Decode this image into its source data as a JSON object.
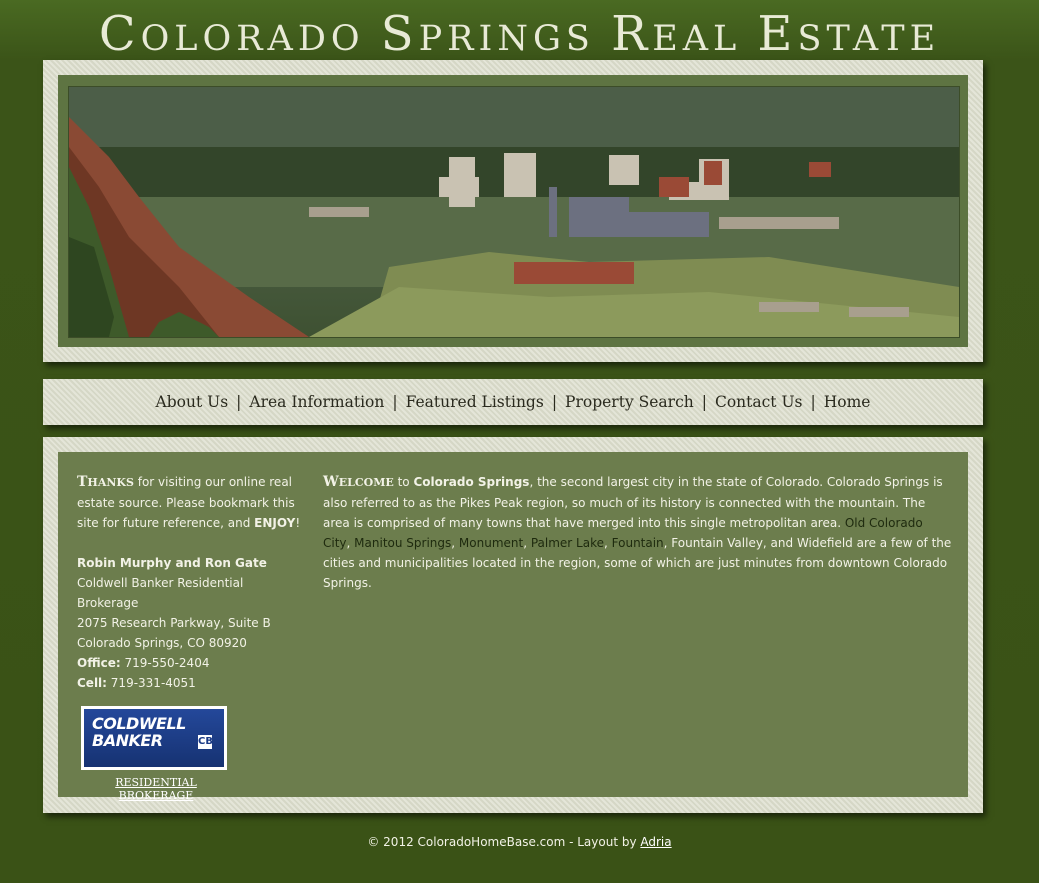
{
  "header": {
    "title_words": [
      {
        "cap": "C",
        "rest": "olorado"
      },
      {
        "cap": "S",
        "rest": "prings"
      },
      {
        "cap": "R",
        "rest": "eal"
      },
      {
        "cap": "E",
        "rest": "state"
      }
    ]
  },
  "nav": {
    "items": [
      "About Us",
      "Area Information",
      "Featured Listings",
      "Property Search",
      "Contact Us",
      "Home"
    ],
    "separator": "|"
  },
  "sidebar": {
    "lead_cap": "T",
    "lead_rest": "hanks",
    "intro": " for visiting our online real estate source. Please bookmark this site for future reference, and ",
    "enjoy": "ENJOY",
    "enjoy_after": "!",
    "agents": "Robin Murphy and Ron Gate",
    "brokerage": "Coldwell Banker Residential Brokerage",
    "address1": "2075 Research Parkway, Suite B",
    "address2": "Colorado Springs, CO 80920",
    "office_label": "Office:",
    "office_phone": " 719-550-2404",
    "cell_label": "Cell:",
    "cell_phone": " 719-331-4051",
    "logo_line1": "COLDWELL",
    "logo_line2": "BANKER",
    "logo_mark": "CB",
    "logo_sub": "RESIDENTIAL BROKERAGE"
  },
  "main": {
    "lead_cap": "W",
    "lead_rest": "elcome",
    "t1": " to ",
    "city_bold": "Colorado Springs",
    "t2": ", the second largest city in the state of Colorado. Colorado Springs is also referred to as the Pikes Peak region, so much of its history is connected with the mountain. The area is comprised of many towns that have merged into this single metropolitan area. ",
    "links": [
      "Old Colorado City",
      "Manitou Springs",
      "Monument",
      "Palmer Lake",
      "Fountain"
    ],
    "comma": ", ",
    "t3": ", Fountain Valley, and Widefield are a few of the cities and municipalities located in the region, some of which are just minutes from downtown Colorado Springs."
  },
  "footer": {
    "text": "© 2012 ColoradoHomeBase.com - Layout by ",
    "link": "Adria"
  }
}
